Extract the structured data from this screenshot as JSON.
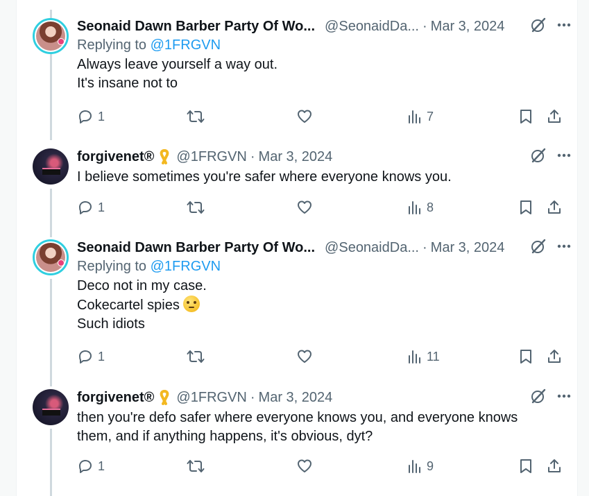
{
  "tweets": [
    {
      "name": "Seonaid Dawn Barber Party Of Wo...",
      "handle": "@SeonaidDa...",
      "sep": "·",
      "date": "Mar 3, 2024",
      "replying_label": "Replying to",
      "replying_to": "@1FRGVN",
      "lines": [
        "Always leave yourself a way out.",
        "It's insane not to"
      ],
      "counts": {
        "replies": "1",
        "retweets": "",
        "likes": "",
        "views": "7"
      }
    },
    {
      "name": "forgivenet®",
      "handle": "@1FRGVN",
      "sep": "·",
      "date": "Mar 3, 2024",
      "lines": [
        "I believe sometimes you're safer where everyone knows you."
      ],
      "counts": {
        "replies": "1",
        "retweets": "",
        "likes": "",
        "views": "8"
      }
    },
    {
      "name": "Seonaid Dawn Barber Party Of Wo...",
      "handle": "@SeonaidDa...",
      "sep": "·",
      "date": "Mar 3, 2024",
      "replying_label": "Replying to",
      "replying_to": "@1FRGVN",
      "lines": [
        "Deco not in my case.",
        "Cokecartel spies",
        "Such idiots"
      ],
      "counts": {
        "replies": "1",
        "retweets": "",
        "likes": "",
        "views": "11"
      }
    },
    {
      "name": "forgivenet®",
      "handle": "@1FRGVN",
      "sep": "·",
      "date": "Mar 3, 2024",
      "lines": [
        "then you're defo safer where everyone knows you, and everyone knows",
        "them, and if anything happens, it's obvious, dyt?"
      ],
      "counts": {
        "replies": "1",
        "retweets": "",
        "likes": "",
        "views": "9"
      }
    }
  ],
  "icons": {
    "more": "more-icon",
    "grok": "grok-icon",
    "reply": "reply-icon",
    "retweet": "retweet-icon",
    "like": "like-icon",
    "views": "views-icon",
    "bookmark": "bookmark-icon",
    "share": "share-icon",
    "ribbon": "yellow-ribbon-icon",
    "emoji": "face-with-rolling-eyes-emoji"
  },
  "colors": {
    "link": "#1d9bf0",
    "secondary": "#536471",
    "text": "#0f1419",
    "ring": "#2fcfe0"
  }
}
